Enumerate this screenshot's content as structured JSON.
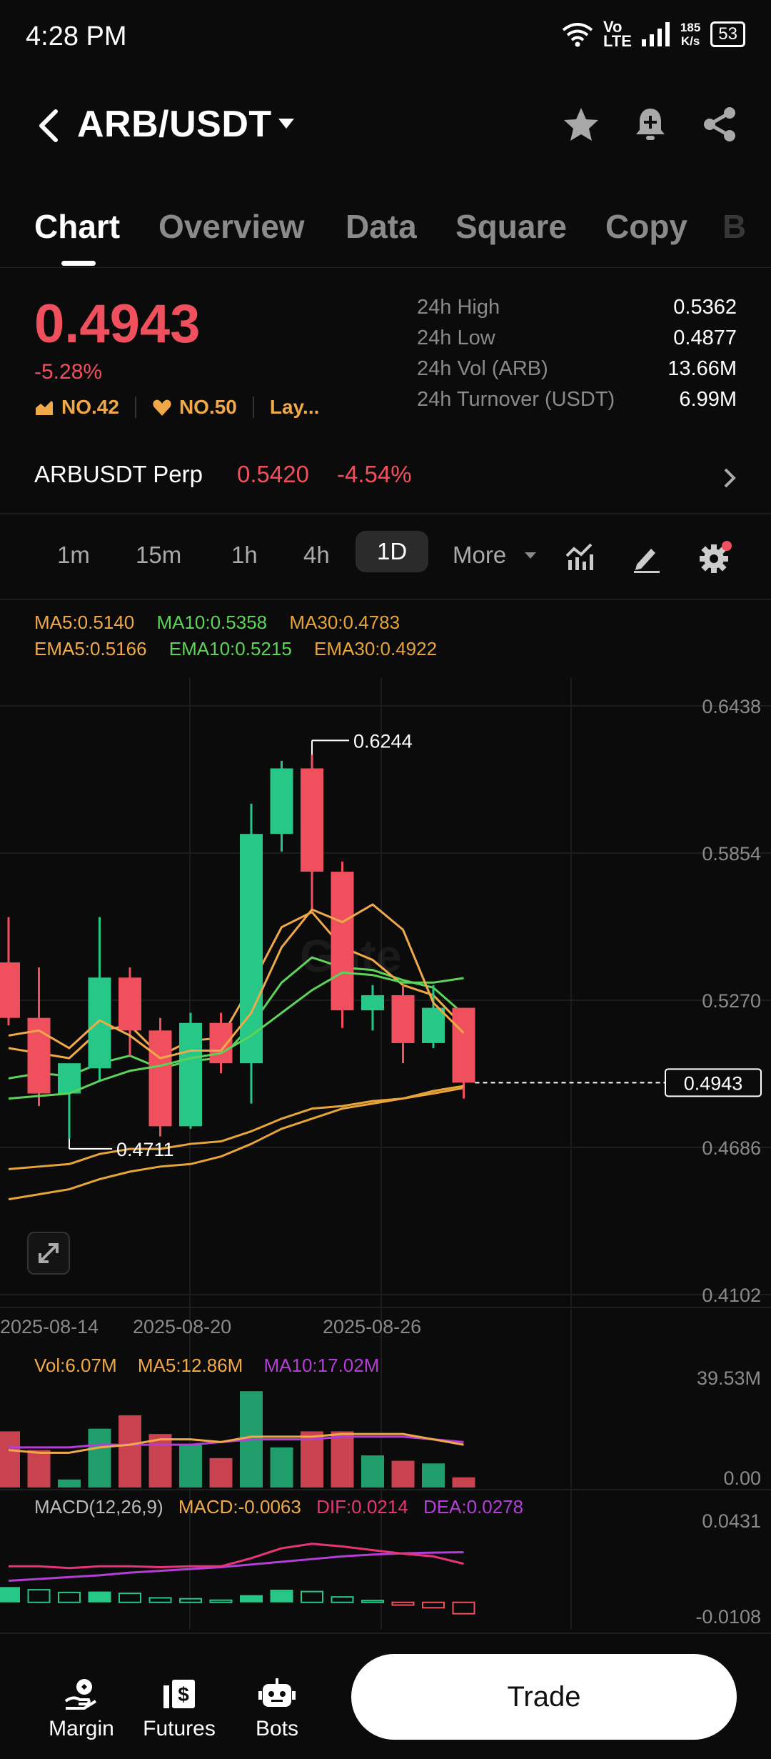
{
  "status_bar": {
    "time": "4:28 PM",
    "net": "Vo\nLTE",
    "speed_top": "185",
    "speed_bot": "K/s",
    "battery": "53"
  },
  "header": {
    "pair": "ARB/USDT"
  },
  "tabs": [
    {
      "label": "Chart"
    },
    {
      "label": "Overview"
    },
    {
      "label": "Data"
    },
    {
      "label": "Square"
    },
    {
      "label": "Copy"
    },
    {
      "label": "B"
    }
  ],
  "ticker": {
    "price": "0.4943",
    "change_pct": "-5.28%",
    "rank1": "NO.42",
    "rank2": "NO.50",
    "rank3": "Lay...",
    "stats": [
      {
        "label": "24h High",
        "value": "0.5362"
      },
      {
        "label": "24h Low",
        "value": "0.4877"
      },
      {
        "label": "24h Vol (ARB)",
        "value": "13.66M"
      },
      {
        "label": "24h Turnover (USDT)",
        "value": "6.99M"
      }
    ]
  },
  "perp": {
    "name": "ARBUSDT Perp",
    "price": "0.5420",
    "change": "-4.54%"
  },
  "timeframes": [
    "1m",
    "15m",
    "1h",
    "4h",
    "1D"
  ],
  "timeframe_more": "More",
  "indicators": {
    "ma5": "MA5:0.5140",
    "ma10": "MA10:0.5358",
    "ma30": "MA30:0.4783",
    "ema5": "EMA5:0.5166",
    "ema10": "EMA10:0.5215",
    "ema30": "EMA30:0.4922"
  },
  "colors": {
    "up": "#26c787",
    "down": "#f0505e",
    "ma5": "#f0a94a",
    "ma10": "#5ed35a",
    "ma30": "#e6a43a",
    "purple": "#b33fd6",
    "pink": "#e8357a"
  },
  "watermark": "Gate",
  "chart_data": {
    "type": "candlestick",
    "y_ticks": [
      "0.6438",
      "0.5854",
      "0.5270",
      "0.4686",
      "0.4102"
    ],
    "x_ticks": [
      "2025-08-14",
      "2025-08-20",
      "2025-08-26"
    ],
    "ylim": [
      0.4102,
      0.6438
    ],
    "high_label": "0.6244",
    "low_label": "0.4711",
    "last_label": "0.4943",
    "candles": [
      {
        "o": 0.542,
        "h": 0.56,
        "l": 0.517,
        "c": 0.52
      },
      {
        "o": 0.52,
        "h": 0.54,
        "l": 0.485,
        "c": 0.49
      },
      {
        "o": 0.49,
        "h": 0.5,
        "l": 0.472,
        "c": 0.502
      },
      {
        "o": 0.5,
        "h": 0.56,
        "l": 0.495,
        "c": 0.536
      },
      {
        "o": 0.536,
        "h": 0.54,
        "l": 0.505,
        "c": 0.515
      },
      {
        "o": 0.515,
        "h": 0.52,
        "l": 0.473,
        "c": 0.477
      },
      {
        "o": 0.477,
        "h": 0.522,
        "l": 0.476,
        "c": 0.518
      },
      {
        "o": 0.518,
        "h": 0.522,
        "l": 0.498,
        "c": 0.502
      },
      {
        "o": 0.502,
        "h": 0.605,
        "l": 0.486,
        "c": 0.593
      },
      {
        "o": 0.593,
        "h": 0.622,
        "l": 0.586,
        "c": 0.619
      },
      {
        "o": 0.619,
        "h": 0.6244,
        "l": 0.562,
        "c": 0.578
      },
      {
        "o": 0.578,
        "h": 0.582,
        "l": 0.516,
        "c": 0.523
      },
      {
        "o": 0.523,
        "h": 0.533,
        "l": 0.515,
        "c": 0.529
      },
      {
        "o": 0.529,
        "h": 0.533,
        "l": 0.502,
        "c": 0.51
      },
      {
        "o": 0.51,
        "h": 0.533,
        "l": 0.508,
        "c": 0.524
      },
      {
        "o": 0.524,
        "h": 0.524,
        "l": 0.488,
        "c": 0.4943
      }
    ],
    "ma5": [
      0.513,
      0.515,
      0.508,
      0.519,
      0.513,
      0.504,
      0.507,
      0.507,
      0.522,
      0.548,
      0.563,
      0.558,
      0.565,
      0.555,
      0.526,
      0.514
    ],
    "ma10": [
      0.488,
      0.489,
      0.49,
      0.495,
      0.499,
      0.501,
      0.504,
      0.506,
      0.513,
      0.522,
      0.531,
      0.538,
      0.537,
      0.534,
      0.534,
      0.5358
    ],
    "ma30": [
      0.448,
      0.45,
      0.452,
      0.456,
      0.459,
      0.461,
      0.462,
      0.465,
      0.47,
      0.476,
      0.48,
      0.484,
      0.486,
      0.488,
      0.491,
      0.493
    ],
    "ema5": [
      0.508,
      0.506,
      0.504,
      0.515,
      0.517,
      0.505,
      0.511,
      0.512,
      0.533,
      0.556,
      0.562,
      0.548,
      0.543,
      0.533,
      0.529,
      0.5166
    ],
    "ema10": [
      0.496,
      0.498,
      0.497,
      0.502,
      0.505,
      0.5,
      0.503,
      0.504,
      0.517,
      0.534,
      0.544,
      0.54,
      0.539,
      0.535,
      0.532,
      0.5215
    ],
    "ema30": [
      0.46,
      0.461,
      0.462,
      0.466,
      0.468,
      0.468,
      0.47,
      0.471,
      0.475,
      0.48,
      0.484,
      0.485,
      0.487,
      0.488,
      0.49,
      0.4922
    ],
    "volume": {
      "labels": {
        "vol": "Vol:6.07M",
        "ma5": "MA5:12.86M",
        "ma10": "MA10:17.02M"
      },
      "y_ticks": [
        "39.53M",
        "0.00"
      ],
      "ylim": [
        0,
        39.53
      ],
      "values": [
        21,
        14,
        3,
        22,
        27,
        20,
        16,
        11,
        36,
        15,
        21,
        21,
        12,
        10,
        9,
        3.8
      ],
      "ma5": [
        14,
        13,
        13,
        15,
        16,
        18,
        18,
        17,
        19,
        19,
        19,
        20,
        20,
        20,
        18,
        16
      ],
      "ma10": [
        15,
        15,
        15,
        16,
        16,
        16,
        16,
        17,
        18,
        18,
        18,
        19,
        19,
        19,
        18,
        17
      ]
    },
    "macd": {
      "labels": {
        "name": "MACD(12,26,9)",
        "macd": "MACD:-0.0063",
        "dif": "DIF:0.0214",
        "dea": "DEA:0.0278"
      },
      "y_ticks": [
        "0.0431",
        "-0.0108"
      ],
      "ylim": [
        -0.0108,
        0.0431
      ],
      "hist": [
        0.0085,
        0.007,
        0.0055,
        0.006,
        0.005,
        0.0025,
        0.002,
        0.0012,
        0.004,
        0.007,
        0.006,
        0.003,
        0.001,
        -0.0015,
        -0.003,
        -0.0063
      ],
      "dif": [
        0.02,
        0.02,
        0.019,
        0.02,
        0.02,
        0.0195,
        0.02,
        0.02,
        0.0245,
        0.03,
        0.0325,
        0.031,
        0.029,
        0.027,
        0.0255,
        0.0214
      ],
      "dea": [
        0.012,
        0.013,
        0.014,
        0.015,
        0.0165,
        0.0175,
        0.0185,
        0.0195,
        0.021,
        0.0225,
        0.024,
        0.0255,
        0.0265,
        0.0272,
        0.0276,
        0.0278
      ]
    }
  },
  "bottom_nav": [
    {
      "label": "Margin"
    },
    {
      "label": "Futures"
    },
    {
      "label": "Bots"
    }
  ],
  "trade_button": "Trade"
}
